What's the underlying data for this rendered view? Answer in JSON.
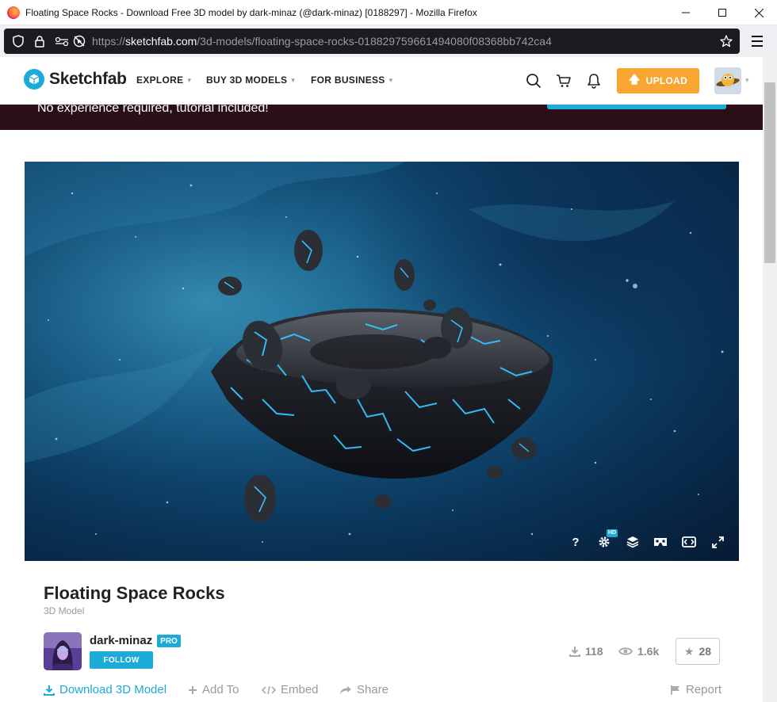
{
  "window": {
    "title": "Floating Space Rocks - Download Free 3D model by dark-minaz (@dark-minaz) [0188297] - Mozilla Firefox"
  },
  "browser": {
    "url_prefix": "https://",
    "url_host": "sketchfab.com",
    "url_path": "/3d-models/floating-space-rocks-018829759661494080f08368bb742ca4"
  },
  "site": {
    "logo_text": "Sketchfab",
    "nav": [
      {
        "label": "EXPLORE"
      },
      {
        "label": "BUY 3D MODELS"
      },
      {
        "label": "FOR BUSINESS"
      }
    ],
    "upload_label": "UPLOAD"
  },
  "promo": {
    "text": "No experience required, tutorial included!"
  },
  "viewer": {
    "hd_badge": "HD",
    "help_label": "?"
  },
  "model": {
    "title": "Floating Space Rocks",
    "subtitle": "3D Model",
    "author": "dark-minaz",
    "author_badge": "PRO",
    "follow_label": "FOLLOW",
    "downloads": "118",
    "views": "1.6k",
    "likes": "28"
  },
  "actions": {
    "download": "Download 3D Model",
    "add_to": "Add To",
    "embed": "Embed",
    "share": "Share",
    "report": "Report"
  },
  "colors": {
    "brand": "#1caad9",
    "upload": "#f8a632",
    "promo_bg": "#2a0f16"
  }
}
